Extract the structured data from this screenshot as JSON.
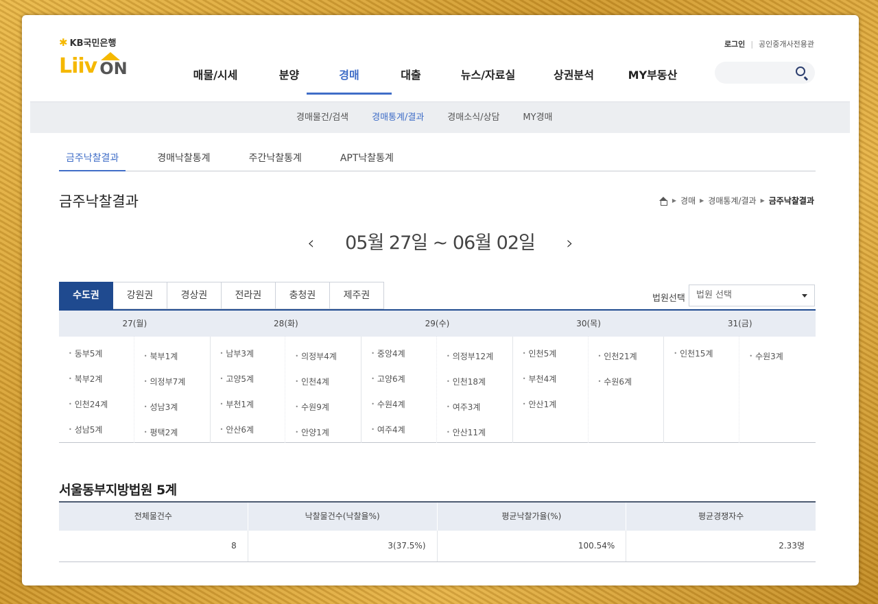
{
  "brand": {
    "kb": "KB국민은행",
    "liiv": "Liiv",
    "on": "ON"
  },
  "util": {
    "login": "로그인",
    "broker": "공인중개사전용관"
  },
  "gnb": [
    "매물/시세",
    "분양",
    "경매",
    "대출",
    "뉴스/자료실",
    "상권분석",
    "MY부동산"
  ],
  "gnb_active_index": 2,
  "subnav": [
    "경매물건/검색",
    "경매통계/결과",
    "경매소식/상담",
    "MY경매"
  ],
  "subnav_active_index": 1,
  "tabs": [
    "금주낙찰결과",
    "경매낙찰통계",
    "주간낙찰통계",
    "APT낙찰통계"
  ],
  "page_title": "금주낙찰결과",
  "breadcrumb": [
    "경매",
    "경매통계/결과",
    "금주낙찰결과"
  ],
  "week_range": "05월 27일 ~ 06월 02일",
  "prev_glyph": "‹",
  "next_glyph": "›",
  "regions": [
    "수도권",
    "강원권",
    "경상권",
    "전라권",
    "충청권",
    "제주권"
  ],
  "region_active_index": 0,
  "court_select": {
    "label": "법원선택",
    "value": "법원 선택"
  },
  "days": [
    {
      "head": "27(월)",
      "left": [
        "동부5계",
        "북부2계",
        "인천24계",
        "성남5계"
      ],
      "right": [
        "북부1계",
        "의정부7계",
        "성남3계",
        "평택2계"
      ]
    },
    {
      "head": "28(화)",
      "left": [
        "남부3계",
        "고양5계",
        "부천1계",
        "안산6계"
      ],
      "right": [
        "의정부4계",
        "인천4계",
        "수원9계",
        "안양1계"
      ]
    },
    {
      "head": "29(수)",
      "left": [
        "중앙4계",
        "고양6계",
        "수원4계",
        "여주4계"
      ],
      "right": [
        "의정부12계",
        "인천18계",
        "여주3계",
        "안산11계"
      ]
    },
    {
      "head": "30(목)",
      "left": [
        "인천5계",
        "부천4계",
        "안산1계"
      ],
      "right": [
        "인천21계",
        "수원6계"
      ]
    },
    {
      "head": "31(금)",
      "left": [
        "인천15계"
      ],
      "right": [
        "수원3계"
      ]
    }
  ],
  "result": {
    "title": "서울동부지방법원 5계",
    "headers": [
      "전체물건수",
      "낙찰물건수(낙찰율%)",
      "평균낙찰가율(%)",
      "평균경쟁자수"
    ],
    "values": [
      "8",
      "3(37.5%)",
      "100.54%",
      "2.33명"
    ]
  }
}
